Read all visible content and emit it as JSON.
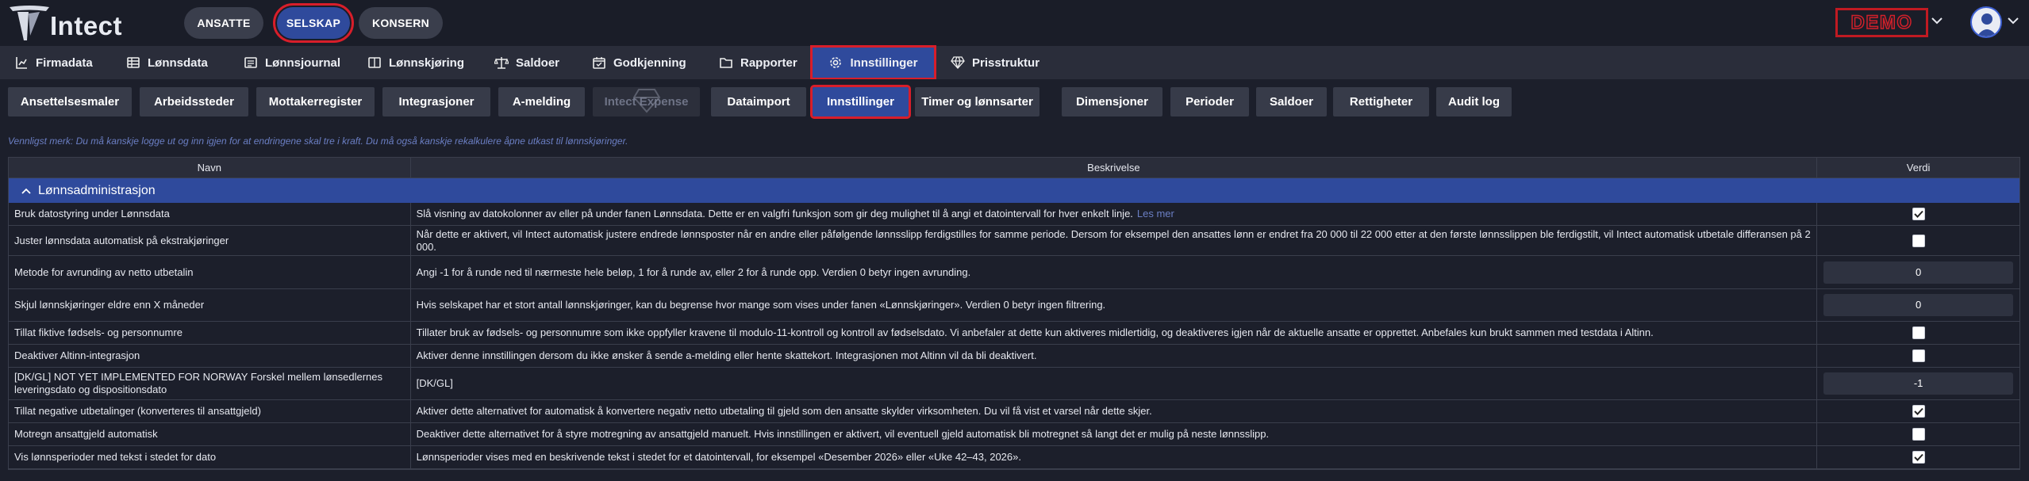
{
  "app": {
    "name": "Intect",
    "demo_label": "DEMO"
  },
  "top_tabs": [
    {
      "label": "ANSATTE",
      "active": false
    },
    {
      "label": "SELSKAP",
      "active": true
    },
    {
      "label": "KONSERN",
      "active": false
    }
  ],
  "main_nav": [
    {
      "label": "Firmadata",
      "icon": "building-chart-icon"
    },
    {
      "label": "Lønnsdata",
      "icon": "grid-icon"
    },
    {
      "label": "Lønnsjournal",
      "icon": "ledger-icon"
    },
    {
      "label": "Lønnskjøring",
      "icon": "book-icon"
    },
    {
      "label": "Saldoer",
      "icon": "scale-icon"
    },
    {
      "label": "Godkjenning",
      "icon": "calendar-check-icon"
    },
    {
      "label": "Rapporter",
      "icon": "folder-icon"
    },
    {
      "label": "Innstillinger",
      "icon": "gear-icon",
      "active": true
    },
    {
      "label": "Prisstruktur",
      "icon": "diamond-icon"
    }
  ],
  "sub_nav": [
    {
      "label": "Ansettelsesmaler"
    },
    {
      "label": "Arbeidssteder"
    },
    {
      "label": "Mottakerregister"
    },
    {
      "label": "Integrasjoner"
    },
    {
      "label": "A-melding"
    },
    {
      "label": "Intect Expense",
      "disabled": true
    },
    {
      "label": "Dataimport"
    },
    {
      "label": "Innstillinger",
      "active": true
    },
    {
      "label": "Timer og lønnsarter"
    },
    {
      "label": "Dimensjoner"
    },
    {
      "label": "Perioder"
    },
    {
      "label": "Saldoer"
    },
    {
      "label": "Rettigheter"
    },
    {
      "label": "Audit log"
    }
  ],
  "notice": "Vennligst merk: Du må kanskje logge ut og inn igjen for at endringene skal tre i kraft. Du må også kanskje rekalkulere åpne utkast til lønnskjøringer.",
  "table": {
    "columns": [
      "Navn",
      "Beskrivelse",
      "Verdi"
    ],
    "group_label": "Lønnsadministrasjon",
    "read_more": "Les mer",
    "rows": [
      {
        "name": "Bruk datostyring under Lønnsdata",
        "description": "Slå visning av datokolonner av eller på under fanen Lønnsdata. Dette er en valgfri funksjon som gir deg mulighet til å angi et datointervall for hver enkelt linje.",
        "type": "checkbox",
        "checked": true,
        "link": true
      },
      {
        "name": "Juster lønnsdata automatisk på ekstrakjøringer",
        "description": "Når dette er aktivert, vil Intect automatisk justere endrede lønnsposter når en andre eller påfølgende lønnsslipp ferdigstilles for samme periode. Dersom for eksempel den ansattes lønn er endret fra 20 000 til 22 000 etter at den første lønnsslippen ble ferdigstilt, vil Intect automatisk utbetale differansen på 2 000.",
        "type": "checkbox",
        "checked": false
      },
      {
        "name": "Metode for avrunding av netto utbetalin",
        "description": "Angi -1 for å runde ned til nærmeste hele beløp, 1 for å runde av, eller 2 for å runde opp. Verdien 0 betyr ingen avrunding.",
        "type": "number",
        "value": "0"
      },
      {
        "name": "Skjul lønnskjøringer eldre enn X måneder",
        "description": "Hvis selskapet har et stort antall lønnskjøringer, kan du begrense hvor mange som vises under fanen «Lønnskjøringer». Verdien 0 betyr ingen filtrering.",
        "type": "number",
        "value": "0"
      },
      {
        "name": "Tillat fiktive fødsels- og personnumre",
        "description": "Tillater bruk av fødsels- og personnumre som ikke oppfyller kravene til modulo-11-kontroll og kontroll av fødselsdato. Vi anbefaler at dette kun aktiveres midlertidig, og deaktiveres igjen når de aktuelle ansatte er opprettet. Anbefales kun brukt sammen med testdata i Altinn.",
        "type": "checkbox",
        "checked": false
      },
      {
        "name": "Deaktiver Altinn-integrasjon",
        "description": "Aktiver denne innstillingen dersom du ikke ønsker å sende a-melding eller hente skattekort. Integrasjonen mot Altinn vil da bli deaktivert.",
        "type": "checkbox",
        "checked": false
      },
      {
        "name": "[DK/GL] NOT YET IMPLEMENTED FOR NORWAY Forskel mellem lønsedlernes leveringsdato og dispositionsdato",
        "description": "[DK/GL]",
        "type": "number",
        "value": "-1"
      },
      {
        "name": "Tillat negative utbetalinger (konverteres til ansattgjeld)",
        "description": "Aktiver dette alternativet for automatisk å konvertere negativ netto utbetaling til gjeld som den ansatte skylder virksomheten. Du vil få vist et varsel når dette skjer.",
        "type": "checkbox",
        "checked": true
      },
      {
        "name": "Motregn ansattgjeld automatisk",
        "description": "Deaktiver dette alternativet for å styre motregning av ansattgjeld manuelt. Hvis innstillingen er aktivert, vil eventuell gjeld automatisk bli motregnet så langt det er mulig på neste lønnsslipp.",
        "type": "checkbox",
        "checked": false
      },
      {
        "name": "Vis lønnsperioder med tekst i stedet for dato",
        "description": "Lønnsperioder vises med en beskrivende tekst i stedet for et datointervall, for eksempel «Desember 2026» eller «Uke 42–43, 2026».",
        "type": "checkbox",
        "checked": true
      }
    ]
  },
  "colors": {
    "background": "#1c1f2b",
    "nav_bg": "#2a2d3a",
    "accent": "#2f4a9c",
    "highlight_border": "#d81e2a",
    "link": "#6b7fc4"
  }
}
